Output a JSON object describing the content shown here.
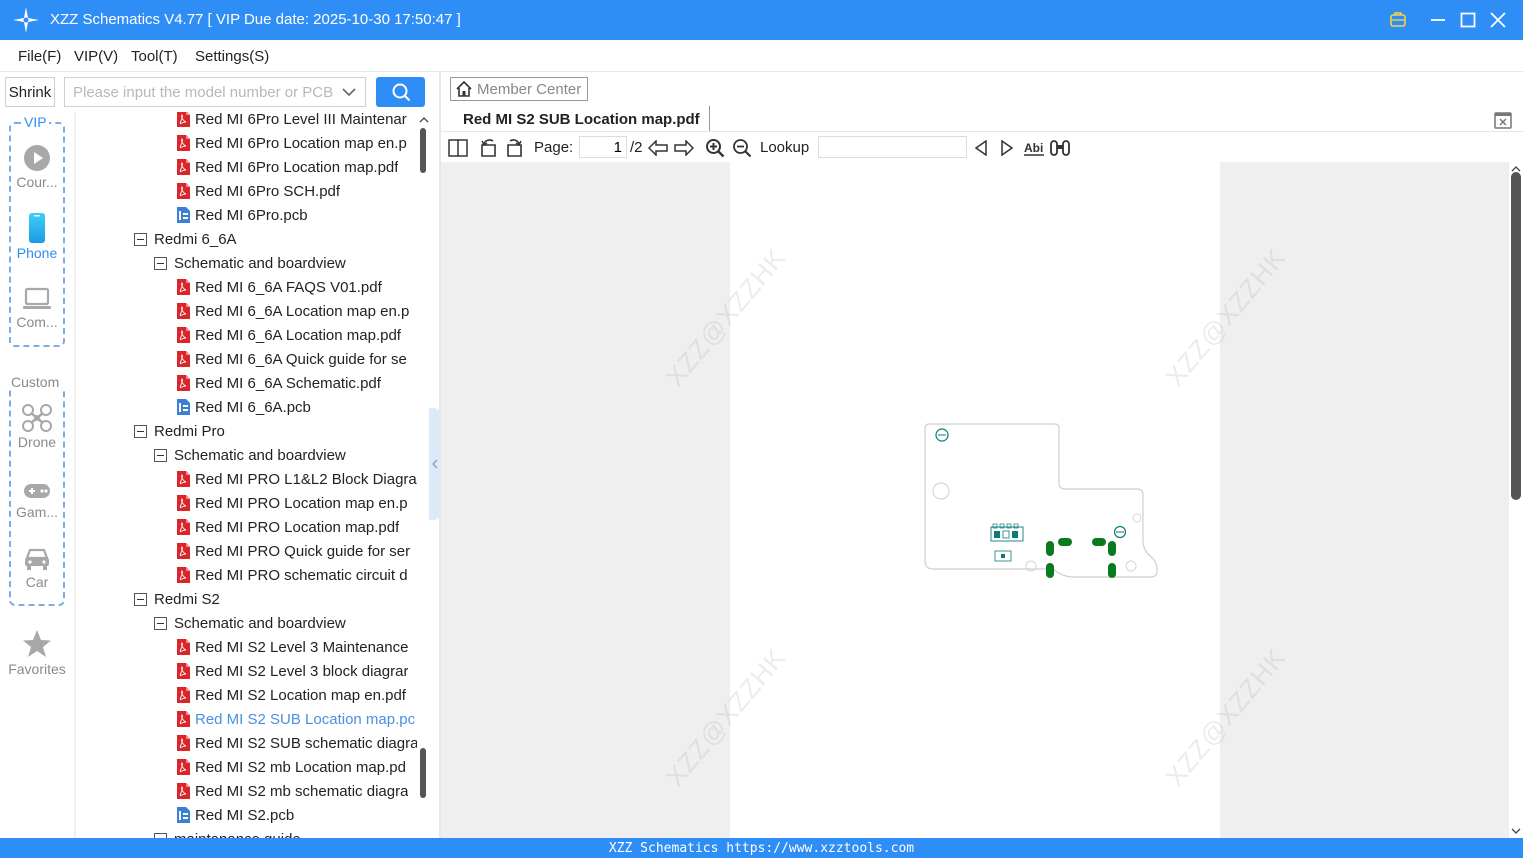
{
  "window": {
    "title": "XZZ Schematics V4.77 [ VIP Due date: 2025-10-30 17:50:47 ]",
    "buttons": [
      "vip-icon",
      "minimize-icon",
      "maximize-icon",
      "close-icon"
    ]
  },
  "menu": [
    "File(F)",
    "VIP(V)",
    "Tool(T)",
    "Settings(S)"
  ],
  "search": {
    "shrink_label": "Shrink",
    "placeholder": "Please input the model number or PCB"
  },
  "categories": {
    "vip_label": "VIP",
    "vip_items": [
      {
        "label": "Cour...",
        "icon": "play-circle-icon",
        "active": false
      },
      {
        "label": "Phone",
        "icon": "phone-icon",
        "active": true
      },
      {
        "label": "Com...",
        "icon": "laptop-icon",
        "active": false
      }
    ],
    "custom_label": "Custom",
    "custom_items": [
      {
        "label": "Drone",
        "icon": "drone-icon"
      },
      {
        "label": "Gam...",
        "icon": "gamepad-icon"
      },
      {
        "label": "Car",
        "icon": "car-icon"
      }
    ],
    "favorites_label": "Favorites"
  },
  "tree": [
    {
      "level": 2,
      "type": "pdf",
      "label": "Red MI 6Pro Level III Maintenar"
    },
    {
      "level": 2,
      "type": "pdf",
      "label": "Red MI 6Pro Location map en.p"
    },
    {
      "level": 2,
      "type": "pdf",
      "label": "Red MI 6Pro Location map.pdf"
    },
    {
      "level": 2,
      "type": "pdf",
      "label": "Red MI 6Pro SCH.pdf"
    },
    {
      "level": 2,
      "type": "pcb",
      "label": "Red MI 6Pro.pcb"
    },
    {
      "level": 0,
      "type": "folder",
      "label": "Redmi 6_6A"
    },
    {
      "level": 1,
      "type": "folder",
      "label": "Schematic and boardview"
    },
    {
      "level": 2,
      "type": "pdf",
      "label": "Red MI 6_6A FAQS V01.pdf"
    },
    {
      "level": 2,
      "type": "pdf",
      "label": "Red MI 6_6A Location map en.p"
    },
    {
      "level": 2,
      "type": "pdf",
      "label": "Red MI 6_6A Location map.pdf"
    },
    {
      "level": 2,
      "type": "pdf",
      "label": "Red MI 6_6A Quick guide for se"
    },
    {
      "level": 2,
      "type": "pdf",
      "label": "Red MI 6_6A Schematic.pdf"
    },
    {
      "level": 2,
      "type": "pcb",
      "label": "Red MI 6_6A.pcb"
    },
    {
      "level": 0,
      "type": "folder",
      "label": "Redmi Pro"
    },
    {
      "level": 1,
      "type": "folder",
      "label": "Schematic and boardview"
    },
    {
      "level": 2,
      "type": "pdf",
      "label": "Red MI PRO L1&L2 Block Diagra"
    },
    {
      "level": 2,
      "type": "pdf",
      "label": "Red MI PRO Location map en.p"
    },
    {
      "level": 2,
      "type": "pdf",
      "label": "Red MI PRO Location map.pdf"
    },
    {
      "level": 2,
      "type": "pdf",
      "label": "Red MI PRO Quick guide for ser"
    },
    {
      "level": 2,
      "type": "pdf",
      "label": "Red MI PRO schematic circuit d"
    },
    {
      "level": 0,
      "type": "folder",
      "label": "Redmi S2"
    },
    {
      "level": 1,
      "type": "folder",
      "label": "Schematic and boardview"
    },
    {
      "level": 2,
      "type": "pdf",
      "label": "Red MI S2 Level 3 Maintenance"
    },
    {
      "level": 2,
      "type": "pdf",
      "label": "Red MI S2 Level 3 block diagrar"
    },
    {
      "level": 2,
      "type": "pdf",
      "label": "Red MI S2 Location map en.pdf"
    },
    {
      "level": 2,
      "type": "pdf",
      "label": "Red MI S2 SUB Location map.pc",
      "selected": true
    },
    {
      "level": 2,
      "type": "pdf",
      "label": "Red MI S2 SUB schematic diagra"
    },
    {
      "level": 2,
      "type": "pdf",
      "label": "Red MI S2 mb Location map.pd"
    },
    {
      "level": 2,
      "type": "pdf",
      "label": "Red MI S2 mb schematic diagra"
    },
    {
      "level": 2,
      "type": "pcb",
      "label": "Red MI S2.pcb"
    },
    {
      "level": 1,
      "type": "folder",
      "label": "maintenance guide"
    }
  ],
  "viewer": {
    "member_center": "Member Center",
    "doc_tab": "Red MI S2 SUB Location map.pdf",
    "page_label": "Page:",
    "page_value": "1",
    "page_total": "/2",
    "lookup_label": "Lookup",
    "lookup_value": "",
    "watermark": "XZZ@XZZHK"
  },
  "status": {
    "text": "XZZ Schematics https://www.xzztools.com"
  },
  "colors": {
    "accent": "#2f8ef5",
    "pdf_red": "#d9262c",
    "pcb_blue": "#3b7fd6",
    "selected_text": "#4a90e2",
    "board_green": "#0a7a1f"
  }
}
